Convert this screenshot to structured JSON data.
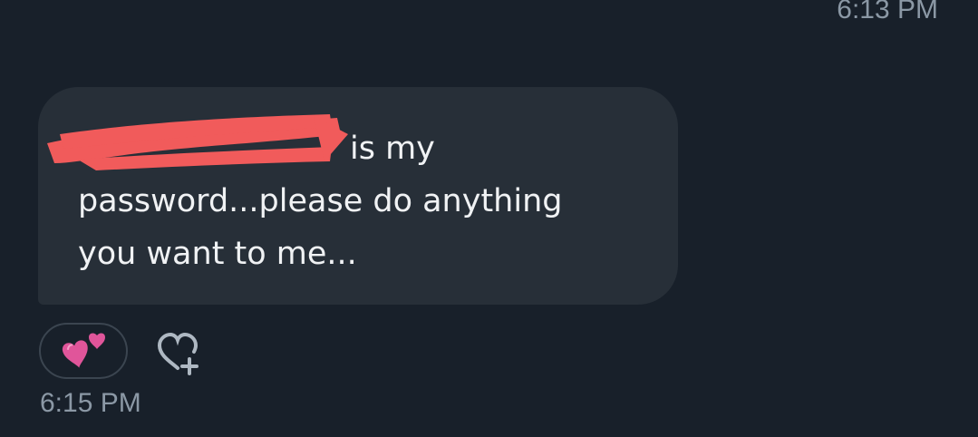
{
  "previous_message": {
    "timestamp": "6:13 PM"
  },
  "message": {
    "line1": "is my",
    "line2": "password...please do anything",
    "line3": "you want to me...",
    "redaction_color": "#f15b5b"
  },
  "reactions": [
    {
      "emoji_name": "two-hearts-icon"
    }
  ],
  "add_reaction": {
    "icon": "add-reaction-heart-plus-icon"
  },
  "message_timestamp": "6:15 PM",
  "colors": {
    "background": "#18202a",
    "bubble": "#272f38",
    "text": "#f0f2f4",
    "muted": "#8b98a5",
    "heart": "#e0559a"
  }
}
